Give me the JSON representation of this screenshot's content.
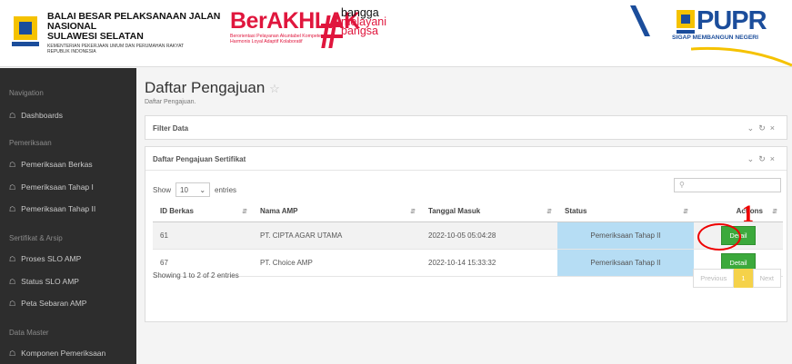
{
  "header": {
    "org_line1": "BALAI BESAR PELAKSANAAN JALAN NASIONAL",
    "org_line2": "SULAWESI SELATAN",
    "org_line3": "KEMENTERIAN PEKERJAAN UMUM DAN PERUMAHAN RAKYAT",
    "org_line4": "REPUBLIK INDONESIA",
    "berakhlak_title": "BerAKHLAK",
    "berakhlak_sub1": "Berorientasi Pelayanan Akuntabel Kompeten",
    "berakhlak_sub2": "Harmonis Loyal Adaptif Kolaboratif",
    "bangga_line1": "bangga",
    "bangga_line2": "melayani",
    "bangga_line3": "bangsa",
    "pupr_title": "PUPR",
    "pupr_sub": "SIGAP MEMBANGUN NEGERI",
    "colors": {
      "brand_red": "#e0163d",
      "pupr_blue": "#1b4d9b",
      "pupr_yellow": "#f5c200"
    }
  },
  "sidebar": {
    "sections": [
      {
        "heading": "Navigation",
        "items": [
          "Dashboards"
        ]
      },
      {
        "heading": "Pemeriksaan",
        "items": [
          "Pemeriksaan Berkas",
          "Pemeriksaan Tahap I",
          "Pemeriksaan Tahap II"
        ]
      },
      {
        "heading": "Sertifikat & Arsip",
        "items": [
          "Proses SLO AMP",
          "Status SLO AMP",
          "Peta Sebaran AMP"
        ]
      },
      {
        "heading": "Data Master",
        "items": [
          "Komponen Pemeriksaan"
        ]
      }
    ],
    "item_icon": "home-icon"
  },
  "page": {
    "title": "Daftar Pengajuan",
    "subtitle": "Daftar Pengajuan."
  },
  "filter_panel": {
    "title": "Filter Data"
  },
  "list_panel": {
    "title": "Daftar Pengajuan Sertifikat",
    "show_label": "Show",
    "entries_value": "10",
    "entries_label": "entries",
    "columns": [
      "ID Berkas",
      "Nama AMP",
      "Tanggal Masuk",
      "Status",
      "Actions"
    ],
    "rows": [
      {
        "id": "61",
        "nama": "PT. CIPTA AGAR UTAMA",
        "tanggal": "2022-10-05 05:04:28",
        "status": "Pemeriksaan Tahap II",
        "action": "Detail"
      },
      {
        "id": "67",
        "nama": "PT. Choice AMP",
        "tanggal": "2022-10-14 15:33:32",
        "status": "Pemeriksaan Tahap II",
        "action": "Detail"
      }
    ],
    "info": "Showing 1 to 2 of 2 entries",
    "pagination": {
      "previous": "Previous",
      "current": "1",
      "next": "Next"
    }
  },
  "annotation": {
    "number": "1"
  }
}
